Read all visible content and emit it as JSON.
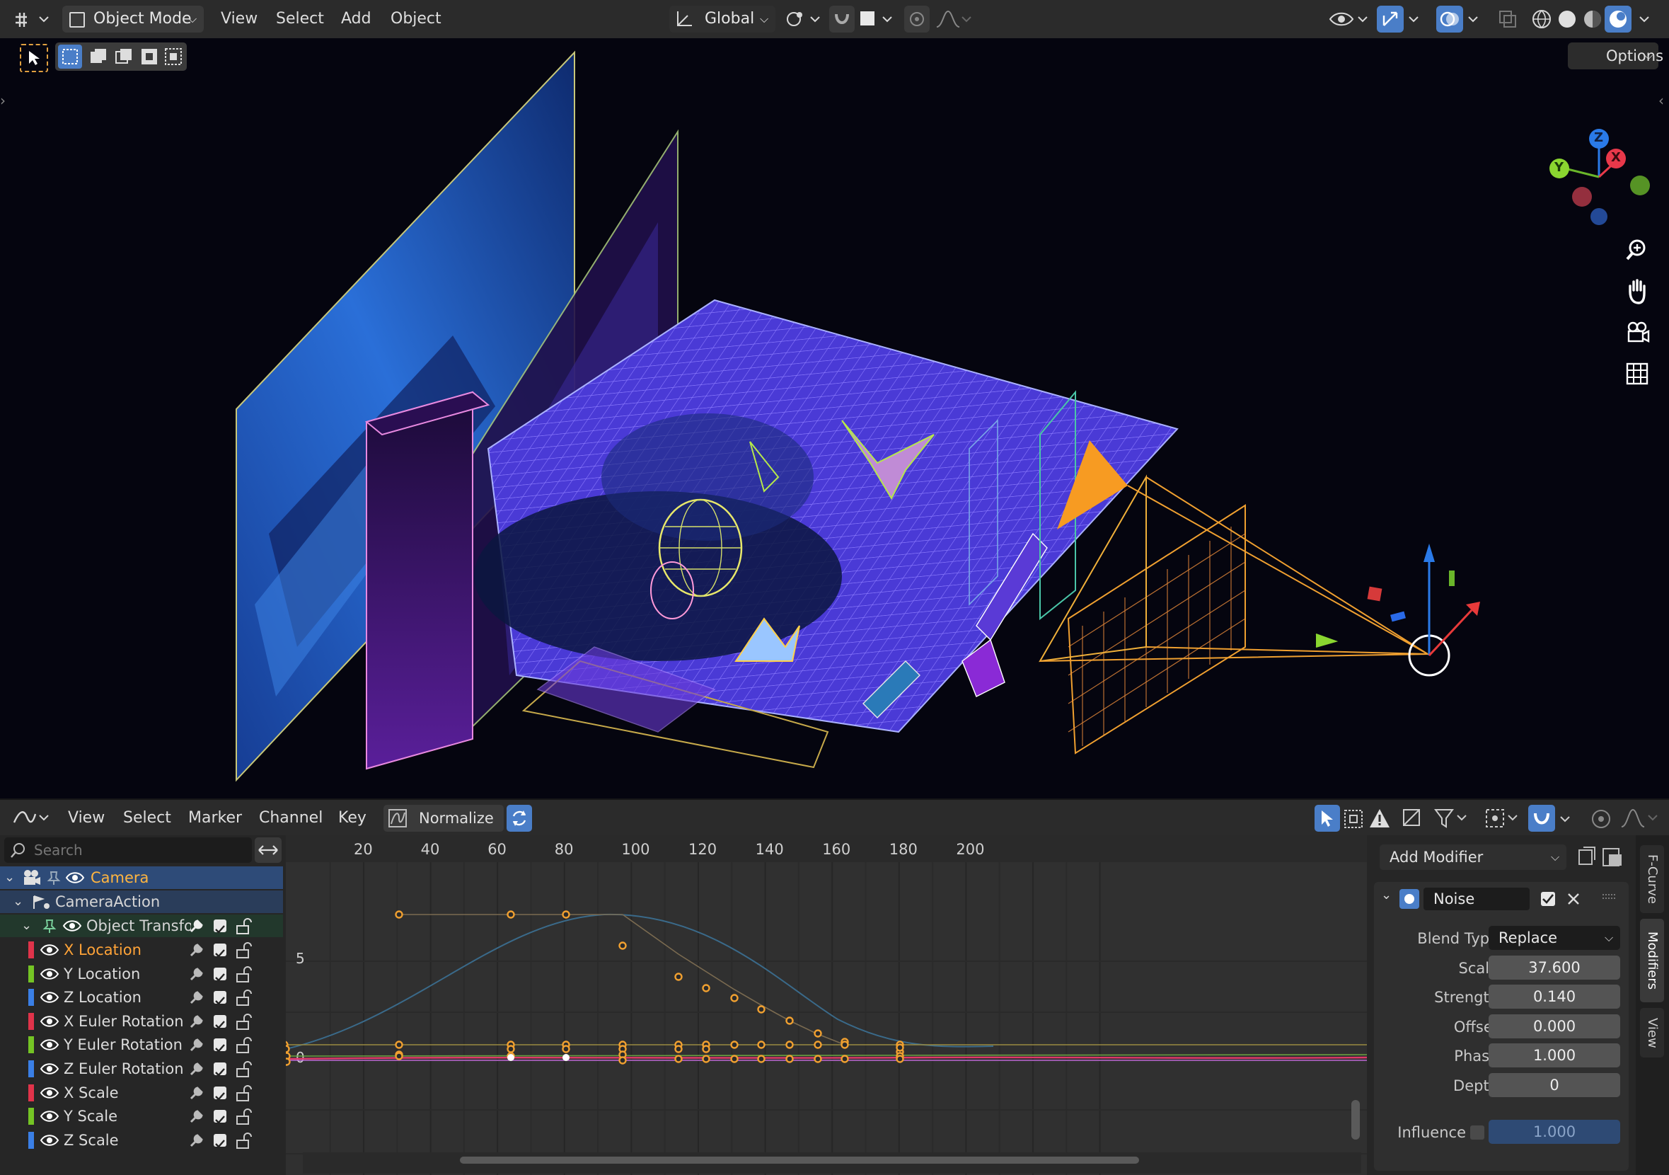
{
  "header": {
    "mode_label": "Object Mode",
    "menus": [
      "View",
      "Select",
      "Add",
      "Object"
    ],
    "orientation_label": "Global"
  },
  "viewport": {
    "options_label": "Options",
    "gizmo_axes": {
      "z": "Z",
      "x": "X",
      "y": "Y"
    }
  },
  "graph_editor": {
    "menus": [
      "View",
      "Select",
      "Marker",
      "Channel",
      "Key"
    ],
    "normalize_label": "Normalize",
    "search_placeholder": "Search",
    "frame_ticks": [
      "20",
      "40",
      "60",
      "80",
      "100",
      "120",
      "140",
      "160",
      "180",
      "200"
    ],
    "value_ticks": [
      "5",
      "0"
    ]
  },
  "channels": {
    "camera": "Camera",
    "action": "CameraAction",
    "group": "Object Transfo",
    "items": [
      {
        "label": "X Location",
        "color": "#e0334a",
        "selected": true
      },
      {
        "label": "Y Location",
        "color": "#74c424"
      },
      {
        "label": "Z Location",
        "color": "#3a7fe6"
      },
      {
        "label": "X Euler Rotation",
        "color": "#e0334a"
      },
      {
        "label": "Y Euler Rotation",
        "color": "#74c424"
      },
      {
        "label": "Z Euler Rotation",
        "color": "#3a7fe6"
      },
      {
        "label": "X Scale",
        "color": "#e0334a"
      },
      {
        "label": "Y Scale",
        "color": "#74c424"
      },
      {
        "label": "Z Scale",
        "color": "#3a7fe6"
      }
    ]
  },
  "modifier_panel": {
    "add_modifier_label": "Add Modifier",
    "modifier_name": "Noise",
    "blend_type_label": "Blend Type",
    "blend_type_value": "Replace",
    "fields": [
      {
        "label": "Scale",
        "value": "37.600"
      },
      {
        "label": "Strength",
        "value": "0.140"
      },
      {
        "label": "Offset",
        "value": "0.000"
      },
      {
        "label": "Phase",
        "value": "1.000"
      },
      {
        "label": "Depth",
        "value": "0"
      }
    ],
    "influence_label": "Influence",
    "influence_value": "1.000"
  },
  "side_tabs": [
    "F-Curve",
    "Modifiers",
    "View"
  ],
  "colors": {
    "accent_blue": "#4a7ec8",
    "selected_orange": "#ffa338",
    "camera_orange": "#f79b22"
  }
}
